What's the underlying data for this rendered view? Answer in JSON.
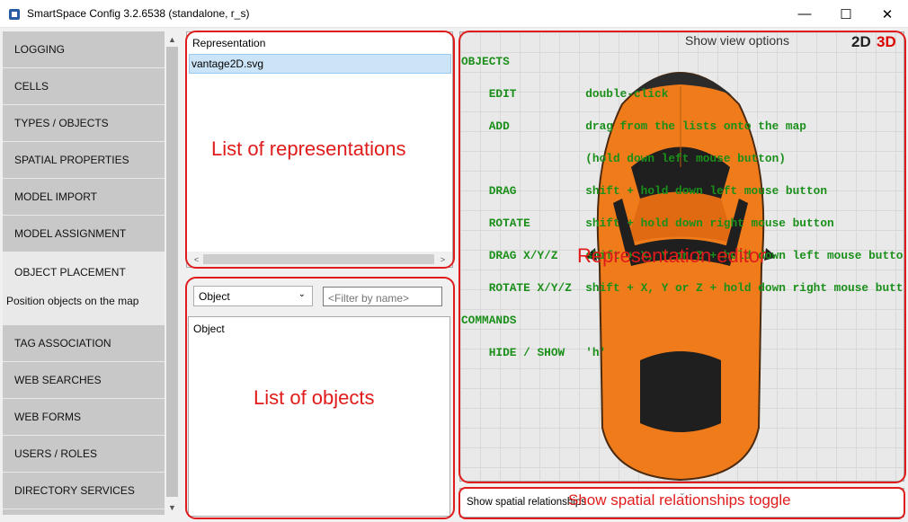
{
  "window": {
    "title": "SmartSpace Config 3.2.6538 (standalone, r_s)",
    "minimize_glyph": "—",
    "maximize_glyph": "☐",
    "close_glyph": "✕"
  },
  "nav": {
    "items": [
      {
        "label": "LOGGING"
      },
      {
        "label": "CELLS"
      },
      {
        "label": "TYPES / OBJECTS"
      },
      {
        "label": "SPATIAL PROPERTIES"
      },
      {
        "label": "MODEL IMPORT"
      },
      {
        "label": "MODEL ASSIGNMENT"
      },
      {
        "label": "OBJECT PLACEMENT",
        "description": "Position objects on the map",
        "active": true
      },
      {
        "label": "TAG ASSOCIATION"
      },
      {
        "label": "WEB SEARCHES"
      },
      {
        "label": "WEB FORMS"
      },
      {
        "label": "USERS / ROLES"
      },
      {
        "label": "DIRECTORY SERVICES"
      }
    ]
  },
  "representations": {
    "header": "Representation",
    "items": [
      "vantage2D.svg"
    ]
  },
  "objects": {
    "type_select": "Object",
    "filter_placeholder": "<Filter by name>",
    "header": "Object"
  },
  "editor": {
    "view_options": "Show view options",
    "mode_2d": "2D",
    "mode_3d": "3D",
    "help_lines": [
      "OBJECTS",
      "    EDIT          double-click",
      "    ADD           drag from the lists onto the map",
      "                  (hold down left mouse button)",
      "    DRAG          shift + hold down left mouse button",
      "    ROTATE        shift + hold down right mouse button",
      "    DRAG X/Y/Z    shift + X, Y or Z + hold down left mouse button",
      "    ROTATE X/Y/Z  shift + X, Y or Z + hold down right mouse button",
      "COMMANDS",
      "    HIDE / SHOW   'h'"
    ],
    "car_color": "#f07b1a"
  },
  "spatial": {
    "label": "Show spatial relationships"
  },
  "annotations": {
    "representations": "List of representations",
    "objects": "List of objects",
    "editor": "Representation editor",
    "spatial": "Show spatial relationships toggle",
    "color": "#e01b1b"
  }
}
